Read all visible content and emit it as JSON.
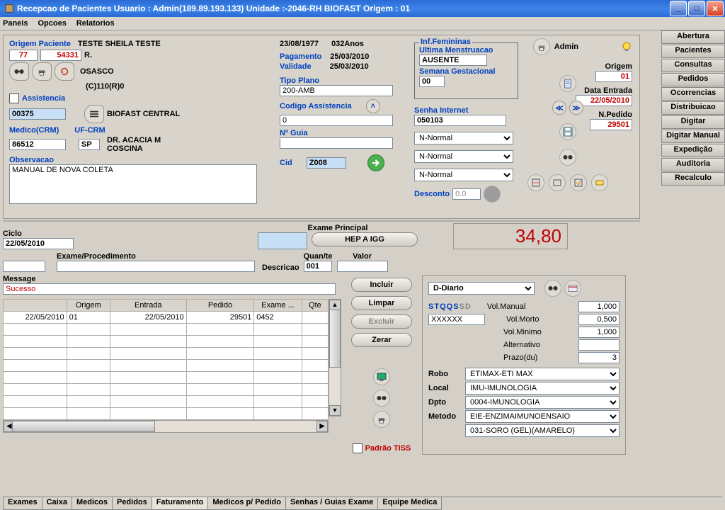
{
  "window_title": "Recepcao de Pacientes Usuario : Admin(189.89.193.133)  Unidade :-2046-RH BIOFAST Origem : 01",
  "menus": {
    "paneis": "Paneis",
    "opcoes": "Opcoes",
    "relatorios": "Relatorios"
  },
  "side_nav": [
    "Abertura",
    "Pacientes",
    "Consultas",
    "Pedidos",
    "Ocorrencias",
    "Distribuicao",
    "Digitar",
    "Digitar Manual",
    "Expedição",
    "Auditoria",
    "Recalculo"
  ],
  "top": {
    "origem_paciente_label": "Origem Paciente",
    "origem_code": "77",
    "paciente_code": "54331",
    "paciente_nome": "TESTE SHEILA TESTE",
    "paciente_r": "R.",
    "paciente_cidade": "OSASCO",
    "paciente_extra": "(C)110(R)0",
    "assistencia_label": "Assistencia",
    "assistencia": "00375",
    "central": "BIOFAST CENTRAL",
    "medico_crm_label": "Medico(CRM)",
    "medico_crm": "86512",
    "uf_crm_label": "UF-CRM",
    "uf_crm": "SP",
    "medico_nome": "DR. ACACIA M COSCINA",
    "observacao_label": "Observacao",
    "observacao": "MANUAL DE NOVA COLETA",
    "data_nasc": "23/08/1977",
    "idade": "032Anos",
    "pagamento_label": "Pagamento",
    "pagamento": "25/03/2010",
    "validade_label": "Validade",
    "validade": "25/03/2010",
    "tipo_plano_label": "Tipo Plano",
    "tipo_plano": "200-AMB",
    "cod_assist_label": "Codigo Assistencia",
    "cod_assist": "0",
    "n_guia_label": "Nº Guia",
    "n_guia": "",
    "cid_label": "Cid",
    "cid": "Z008",
    "fem_group": "Inf.Femininas",
    "ult_menst_label": "Ultima Menstruacao",
    "ult_menst": "AUSENTE",
    "sem_gest_label": "Semana Gestacional",
    "sem_gest": "00",
    "senha_label": "Senha Internet",
    "senha": "050103",
    "sel1": "N-Normal",
    "sel2": "N-Normal",
    "sel3": "N-Normal",
    "desconto_label": "Desconto",
    "desconto": "0.0",
    "admin_label": "Admin",
    "origem_label": "Origem",
    "origem": "01",
    "data_entrada_label": "Data Entrada",
    "data_entrada": "22/05/2010",
    "npedido_label": "N.Pedido",
    "npedido": "29501"
  },
  "mid": {
    "ciclo_label": "Ciclo",
    "ciclo": "22/05/2010",
    "exame_principal_label": "Exame Principal",
    "exame_principal": "HEP A IGG",
    "total": "34,80",
    "exame_proc_label": "Exame/Procedimento",
    "descricao_label": "Descricao",
    "quant_label": "Quan/te",
    "valor_label": "Valor",
    "quant": "001",
    "message_label": "Message",
    "message": "Sucesso",
    "btn_incluir": "Incluir",
    "btn_limpar": "Limpar",
    "btn_excluir": "Excluir",
    "btn_zerar": "Zerar",
    "padrao_tiss": "Padrão TISS",
    "grid_cols": [
      "",
      "Origem",
      "Entrada",
      "Pedido",
      "Exame ...",
      "Qte"
    ],
    "grid_row": {
      "data": "22/05/2010",
      "origem": "01",
      "entrada": "22/05/2010",
      "pedido": "29501",
      "exame": "0452",
      "qte": ""
    }
  },
  "right": {
    "diario": "D-Diario",
    "days": "STQQSSD",
    "xxxxx": "XXXXXX",
    "vol_manual_l": "Vol.Manual",
    "vol_manual": "1,000",
    "vol_morto_l": "Vol.Morto",
    "vol_morto": "0,500",
    "vol_minimo_l": "Vol.Minimo",
    "vol_minimo": "1,000",
    "alternativo_l": "Alternativo",
    "alternativo": "",
    "prazo_l": "Prazo(du)",
    "prazo": "3",
    "robo_l": "Robo",
    "robo": "ETIMAX-ETI MAX",
    "local_l": "Local",
    "local": "IMU-IMUNOLOGIA",
    "dpto_l": "Dpto",
    "dpto": "0004-IMUNOLOGIA",
    "metodo_l": "Metodo",
    "metodo": "EIE-ENZIMAIMUNOENSAIO",
    "extra": "031-SORO (GEL)(AMARELO)"
  },
  "bottom_tabs": [
    "Exames",
    "Caixa",
    "Medicos",
    "Pedidos",
    "Faturamento",
    "Medicos p/ Pedido",
    "Senhas / Guias Exame",
    "Equipe Medica"
  ],
  "bottom_active": 4
}
